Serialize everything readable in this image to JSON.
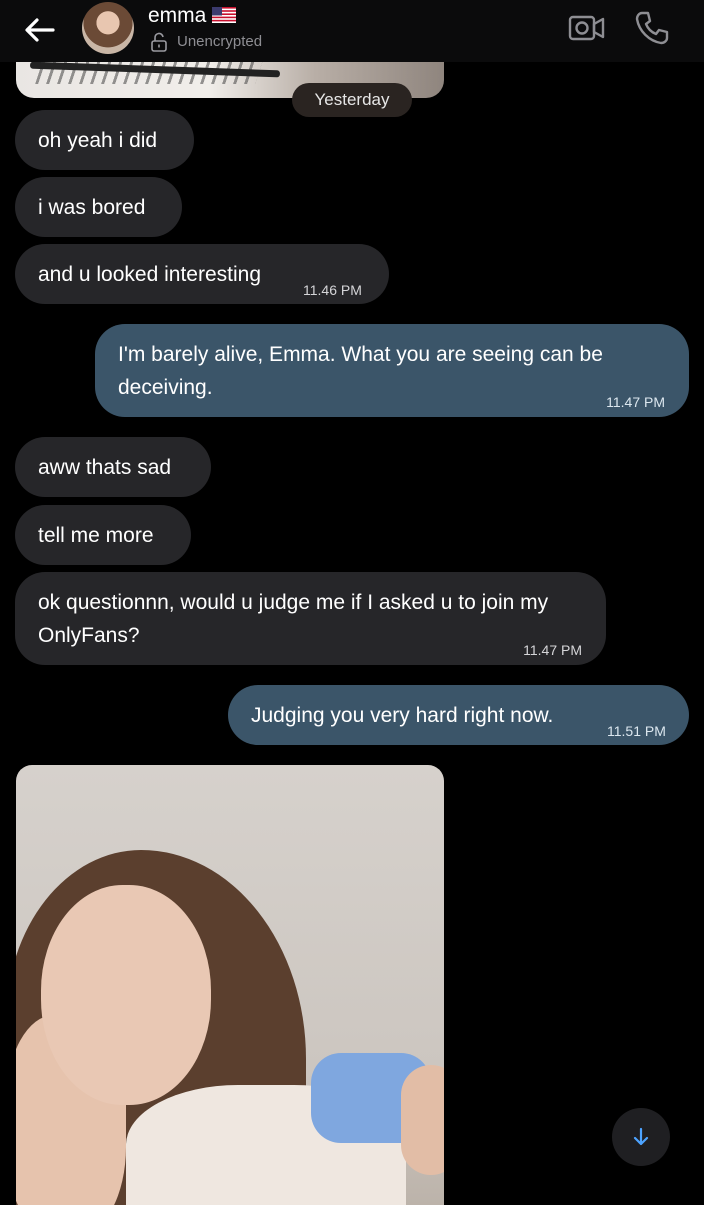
{
  "header": {
    "contact_name": "emma",
    "status": "Unencrypted",
    "icons": [
      "back-arrow-icon",
      "avatar",
      "us-flag-icon",
      "lock-open-icon",
      "video-call-icon",
      "phone-icon"
    ]
  },
  "date_separator": "Yesterday",
  "messages": [
    {
      "direction": "incoming",
      "text": "oh yeah i did",
      "time": ""
    },
    {
      "direction": "incoming",
      "text": "i was bored",
      "time": ""
    },
    {
      "direction": "incoming",
      "text": "and u looked interesting",
      "time": "11.46 PM"
    },
    {
      "direction": "outgoing",
      "text": "I'm barely alive, Emma. What you are seeing can be deceiving.",
      "time": "11.47 PM"
    },
    {
      "direction": "incoming",
      "text": "aww thats sad",
      "time": ""
    },
    {
      "direction": "incoming",
      "text": "tell me more",
      "time": ""
    },
    {
      "direction": "incoming",
      "text": "ok questionnn, would u judge me if I asked u to join my OnlyFans?",
      "time": "11.47 PM"
    },
    {
      "direction": "outgoing",
      "text": "Judging you very hard right now.",
      "time": "11.51 PM"
    }
  ],
  "colors": {
    "background": "#000000",
    "incoming_bubble": "#262629",
    "outgoing_bubble": "#3b5569",
    "secondary_text": "#8e8e93"
  },
  "scroll_button_icon": "arrow-down-icon"
}
